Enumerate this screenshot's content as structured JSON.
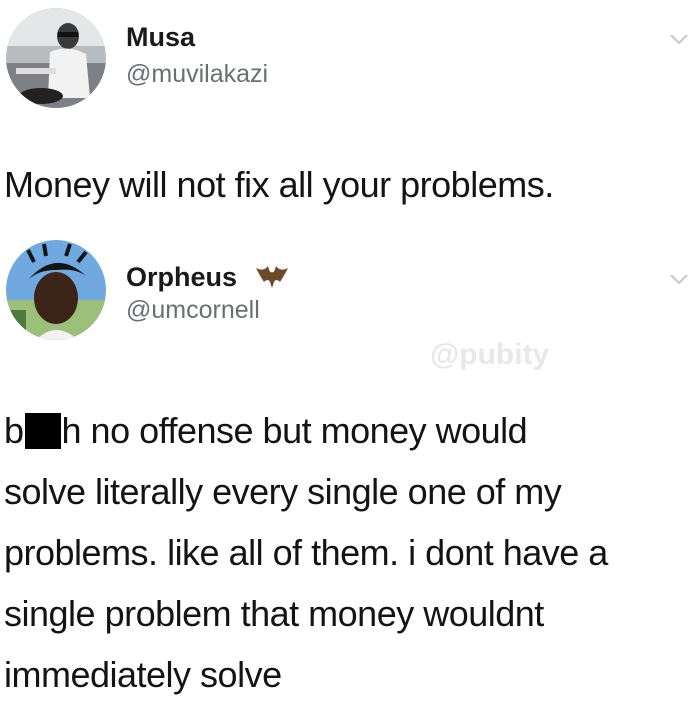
{
  "tweets": [
    {
      "name": "Musa",
      "handle": "@muvilakazi",
      "text": "Money will not fix all your problems."
    },
    {
      "name": "Orpheus",
      "handle": "@umcornell",
      "name_emoji_icon": "bat-icon",
      "text_lines": [
        {
          "pre": "b",
          "post": "h no offense but money would"
        },
        "solve literally every single one of my",
        "problems. like all of them. i dont have a",
        "single problem that money wouldnt",
        "immediately solve"
      ]
    }
  ],
  "watermark": "@pubity",
  "colors": {
    "text": "#141414",
    "handle": "#6b6f73",
    "chevron": "#c4c8cc"
  }
}
